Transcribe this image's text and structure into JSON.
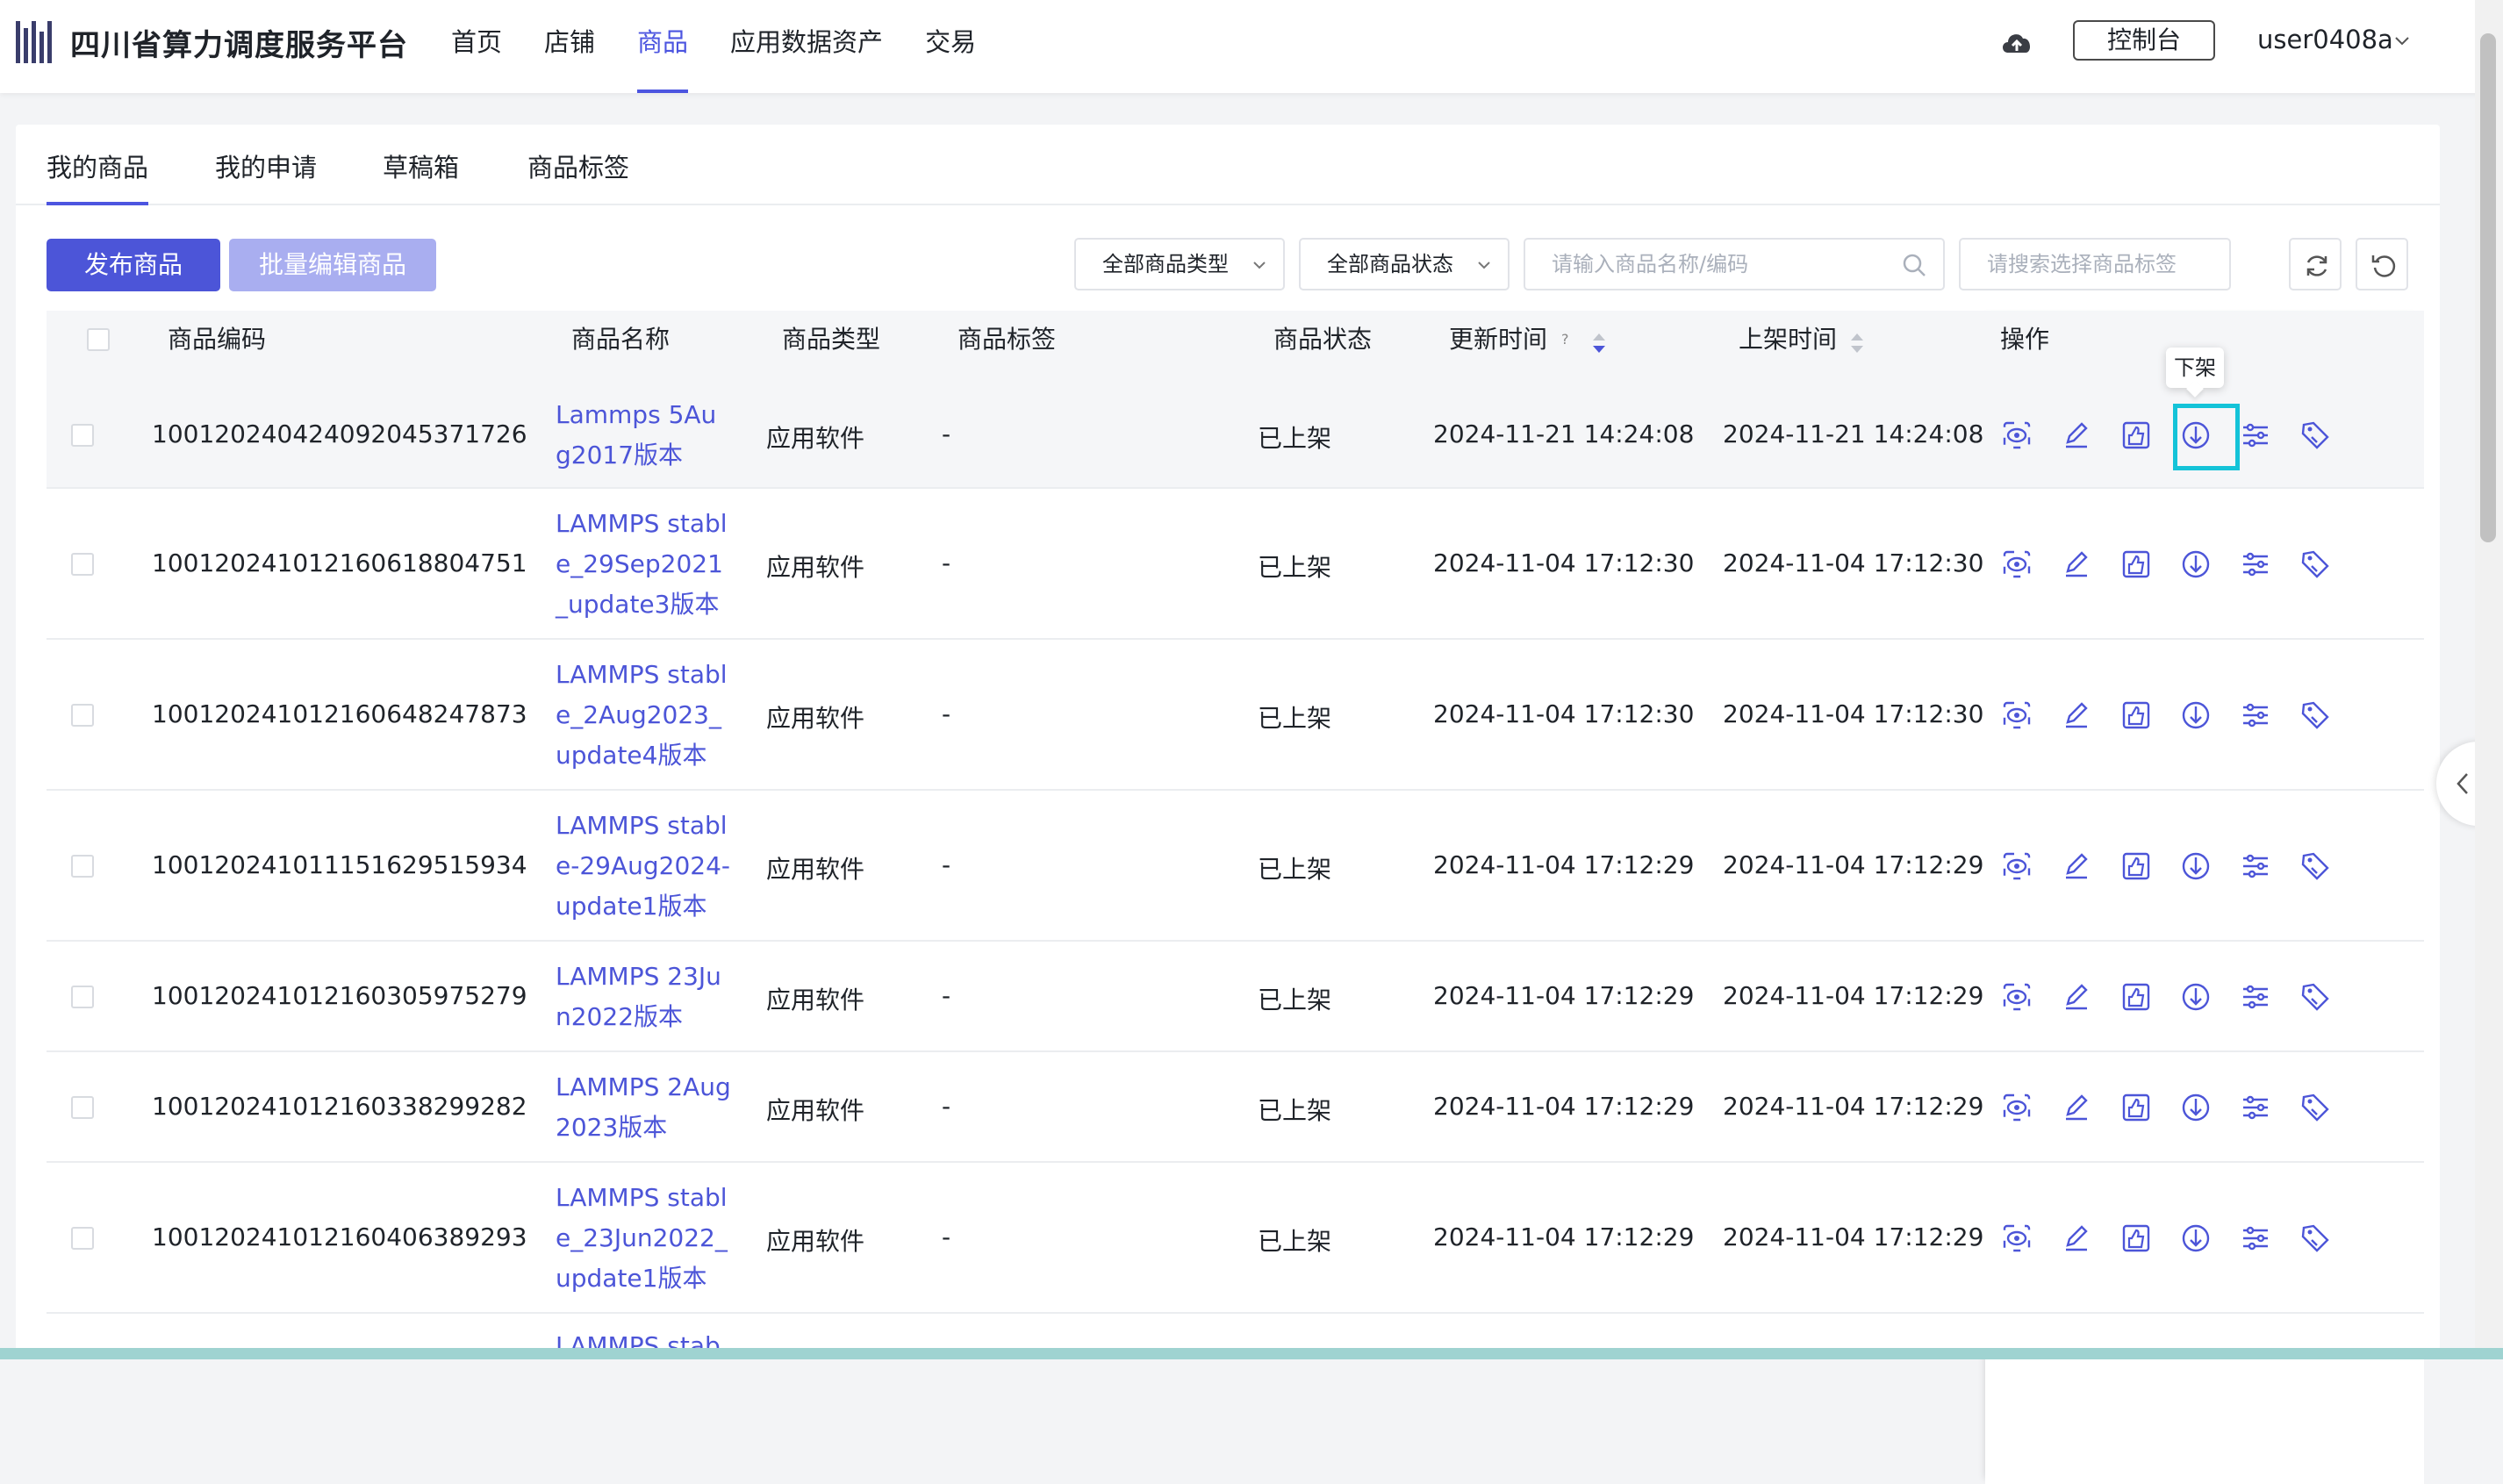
{
  "brand": "四川省算力调度服务平台",
  "nav": [
    "首页",
    "店铺",
    "商品",
    "应用数据资产",
    "交易"
  ],
  "nav_active": "商品",
  "header": {
    "console_label": "控制台",
    "user": "user0408a"
  },
  "tabs": [
    "我的商品",
    "我的申请",
    "草稿箱",
    "商品标签"
  ],
  "toolbar": {
    "publish": "发布商品",
    "batch_edit": "批量编辑商品",
    "type_select": "全部商品类型",
    "status_select": "全部商品状态",
    "search_placeholder": "请输入商品名称/编码",
    "tag_placeholder": "请搜索选择商品标签"
  },
  "table": {
    "headers": {
      "code": "商品编码",
      "name": "商品名称",
      "type": "商品类型",
      "tag": "商品标签",
      "status": "商品状态",
      "updated": "更新时间",
      "listed": "上架时间",
      "ops": "操作",
      "help": "?"
    },
    "rows": [
      {
        "code": "10012024042409204537​1726",
        "name": "Lammps 5Aug2017版本",
        "type": "应用软件",
        "tag": "-",
        "status": "已上架",
        "updated": "2024-11-21 14:24:08",
        "listed": "2024-11-21 14:24:08"
      },
      {
        "code": "1001202410121606188047​51",
        "name": "LAMMPS stable_29Sep2021_update3版本",
        "type": "应用软件",
        "tag": "-",
        "status": "已上架",
        "updated": "2024-11-04 17:12:30",
        "listed": "2024-11-04 17:12:30"
      },
      {
        "code": "1001202410121606482478​73",
        "name": "LAMMPS stable_2Aug2023_update4版本",
        "type": "应用软件",
        "tag": "-",
        "status": "已上架",
        "updated": "2024-11-04 17:12:30",
        "listed": "2024-11-04 17:12:30"
      },
      {
        "code": "1001202410111516295159​34",
        "name": "LAMMPS stable-29Aug2024-update1版本",
        "type": "应用软件",
        "tag": "-",
        "status": "已上架",
        "updated": "2024-11-04 17:12:29",
        "listed": "2024-11-04 17:12:29"
      },
      {
        "code": "1001202410121603059752​79",
        "name": "LAMMPS 23Jun2022版本",
        "type": "应用软件",
        "tag": "-",
        "status": "已上架",
        "updated": "2024-11-04 17:12:29",
        "listed": "2024-11-04 17:12:29"
      },
      {
        "code": "1001202410121603382992​82",
        "name": "LAMMPS 2Aug2023版本",
        "type": "应用软件",
        "tag": "-",
        "status": "已上架",
        "updated": "2024-11-04 17:12:29",
        "listed": "2024-11-04 17:12:29"
      },
      {
        "code": "1001202410121604063892​93",
        "name": "LAMMPS stable_23Jun2022_update1版本",
        "type": "应用软件",
        "tag": "-",
        "status": "已上架",
        "updated": "2024-11-04 17:12:29",
        "listed": "2024-11-04 17:12:29"
      },
      {
        "code": "",
        "name": "LAMMPS stab",
        "type": "",
        "tag": "",
        "status": "",
        "updated": "",
        "listed": ""
      }
    ]
  },
  "tooltip": "下架",
  "colors": {
    "primary": "#4c55d8",
    "highlight": "#14c3d8"
  },
  "icons": [
    "preview-icon",
    "edit-icon",
    "thumbs-up-icon",
    "unlist-icon",
    "settings-icon",
    "tag-icon"
  ]
}
